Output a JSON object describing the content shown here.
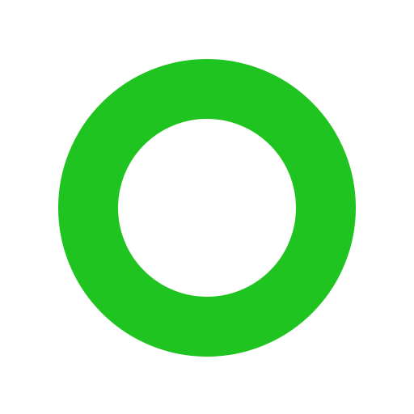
{
  "icon": {
    "name": "ring-icon",
    "color": "#20c420",
    "background": "#ffffff"
  }
}
